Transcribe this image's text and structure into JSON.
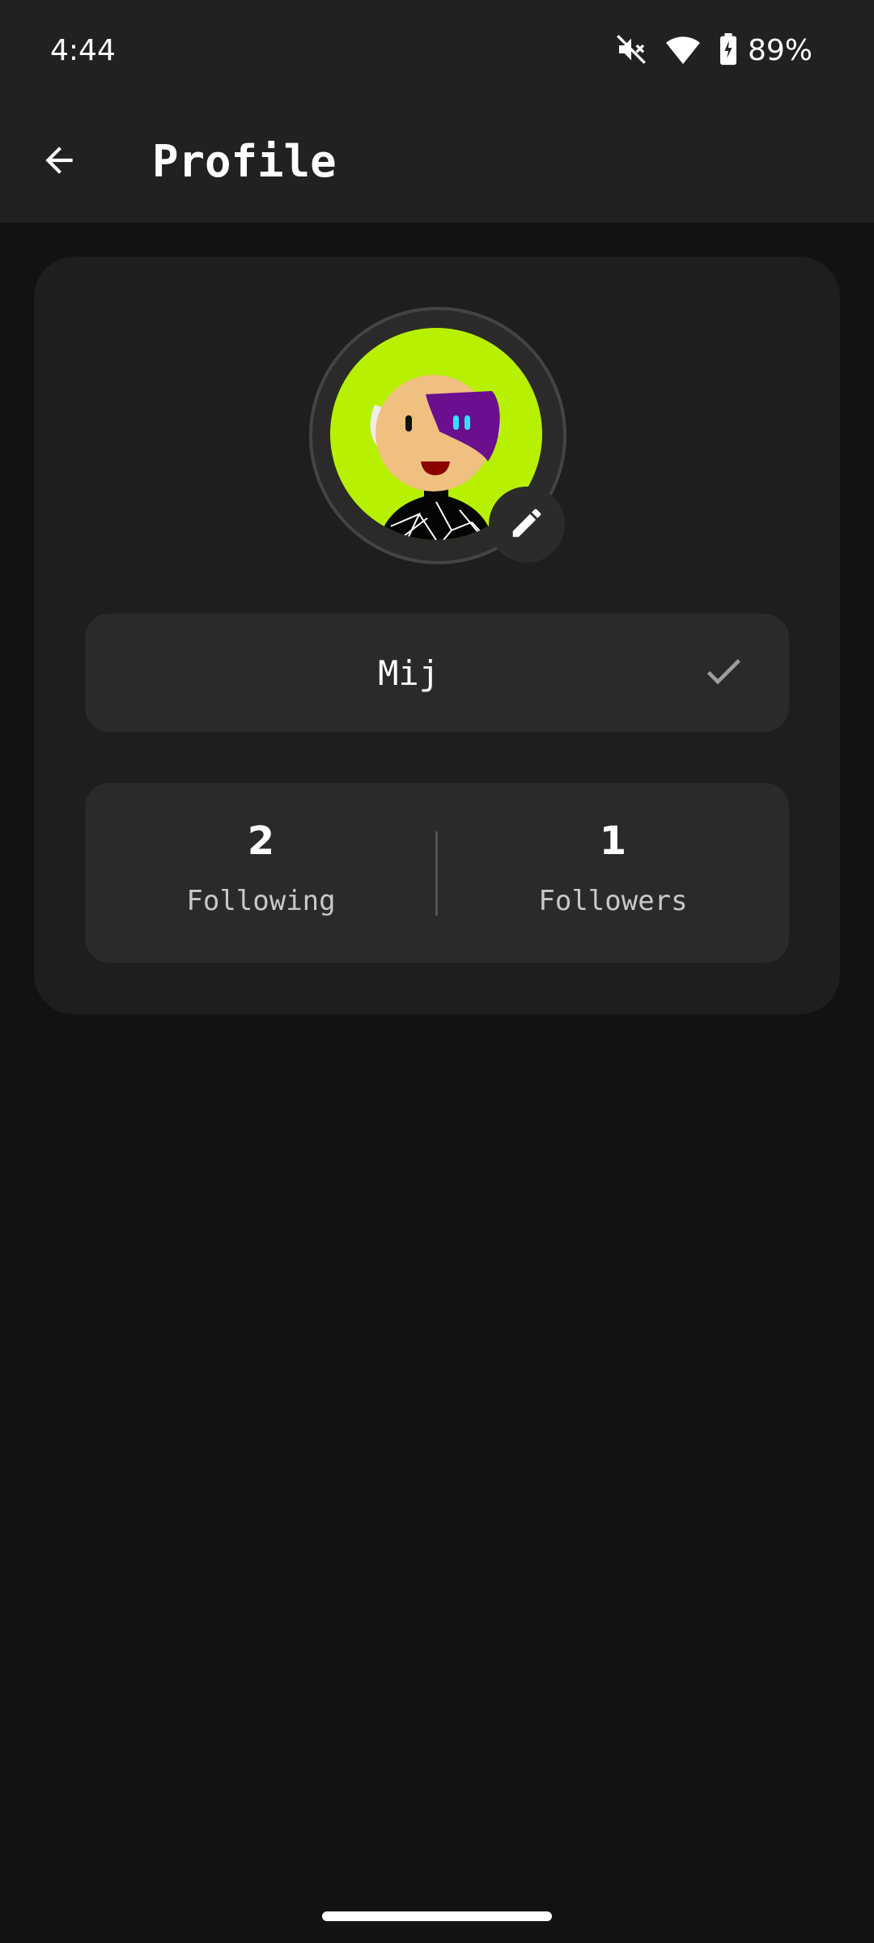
{
  "status_bar": {
    "time": "4:44",
    "battery_percent": "89%",
    "icons": [
      "mute-icon",
      "wifi-icon",
      "battery-charging-icon"
    ]
  },
  "app_bar": {
    "title": "Profile",
    "back_icon": "arrow-back-icon"
  },
  "profile": {
    "name_value": "Mij",
    "edit_icon": "pencil-icon",
    "confirm_icon": "check-icon",
    "stats": [
      {
        "count": "2",
        "label": "Following"
      },
      {
        "count": "1",
        "label": "Followers"
      }
    ]
  },
  "colors": {
    "background": "#121212",
    "bar": "#212121",
    "card": "#1e1e1e",
    "field": "#2a2a2a",
    "avatar_bg": "#b7f000",
    "avatar_hair": "#6b0f8f"
  }
}
